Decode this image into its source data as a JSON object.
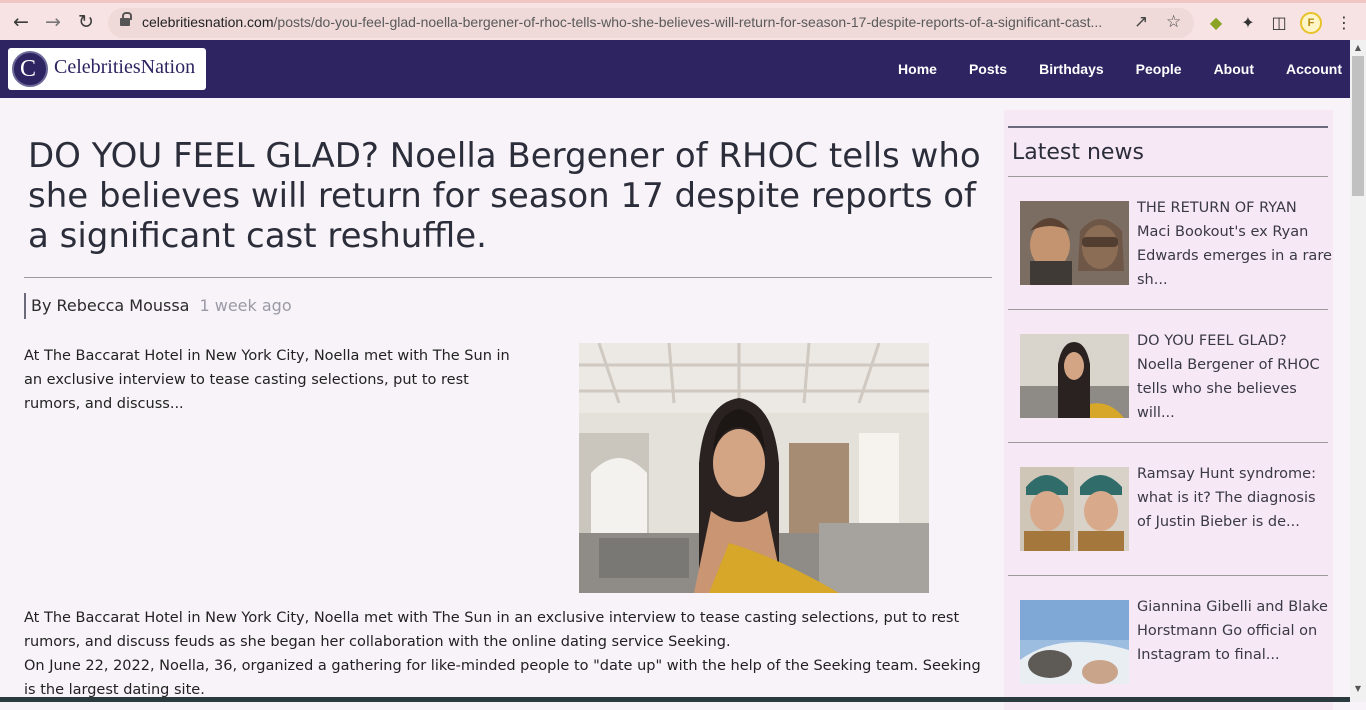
{
  "browser": {
    "url_domain": "celebritiesnation.com",
    "url_path": "/posts/do-you-feel-glad-noella-bergener-of-rhoc-tells-who-she-believes-will-return-for-season-17-despite-reports-of-a-significant-cast...",
    "profile_initial": "F",
    "icons": [
      "back-arrow-icon",
      "forward-arrow-icon",
      "reload-icon",
      "lock-icon",
      "share-icon",
      "bookmark-star-icon",
      "extension-icon",
      "puzzle-icon",
      "sidebar-icon",
      "profile-icon",
      "kebab-menu-icon"
    ]
  },
  "site": {
    "logo_letter": "C",
    "logo_text": "CelebritiesNation",
    "nav": [
      "Home",
      "Posts",
      "Birthdays",
      "People",
      "About",
      "Account"
    ],
    "colors": {
      "header_bg": "#2d2461",
      "sidebar_bg": "#f7e8f6",
      "page_bg": "#f7f3f8"
    }
  },
  "article": {
    "title": "DO YOU FEEL GLAD? Noella Bergener of RHOC tells who she believes will return for season 17 despite reports of a significant cast reshuffle.",
    "byline_prefix": "By ",
    "author": "Rebecca Moussa",
    "time_ago": "1 week ago",
    "lead": "At The Baccarat Hotel in New York City, Noella met with The Sun in an exclusive interview to tease casting selections, put to rest rumors, and discuss...",
    "paragraph_1": "At The Baccarat Hotel in New York City, Noella met with The Sun in an exclusive interview to tease casting selections, put to rest rumors, and discuss feuds as she began her collaboration with the online dating service Seeking.",
    "paragraph_2": "On June 22, 2022, Noella, 36, organized a gathering for like-minded people to \"date up\" with the help of the Seeking team. Seeking is the largest dating site."
  },
  "sidebar": {
    "title": "Latest news",
    "items": [
      {
        "text": "THE RETURN OF RYAN Maci Bookout's ex Ryan Edwards emerges in a rare sh..."
      },
      {
        "text": "DO YOU FEEL GLAD? Noella Bergener of RHOC tells who she believes will..."
      },
      {
        "text": "Ramsay Hunt syndrome: what is it? The diagnosis of Justin Bieber is de..."
      },
      {
        "text": "Giannina Gibelli and Blake Horstmann Go official on Instagram to final..."
      }
    ]
  }
}
